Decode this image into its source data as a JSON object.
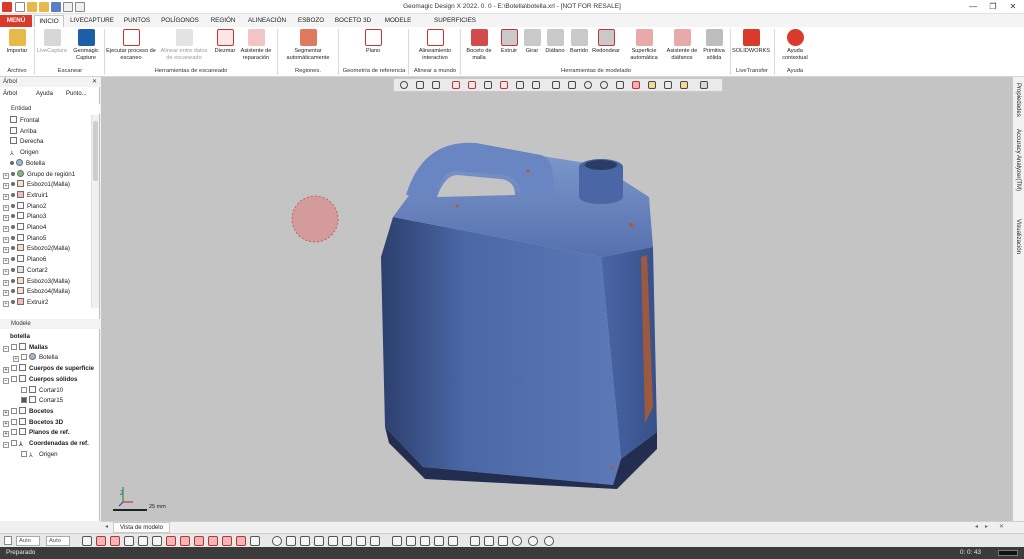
{
  "window": {
    "title": "Geomagic Design X 2022. 0. 0 - E:\\Botella\\botella.xrl - [NOT FOR RESALE]"
  },
  "tabs": [
    "MENÚ",
    "INICIO",
    "LIVECAPTURE",
    "PUNTOS",
    "POLÍGONOS",
    "REGIÓN",
    "ALINEACIÓN",
    "ESBOZO",
    "BOCETO 3D",
    "MODELE",
    "SUPERFICIES EXACTAS"
  ],
  "ribbon": {
    "buttons": {
      "importar": "Importar",
      "livecapture": "LiveCapture",
      "geomagic_capture": "Geomagic Capture",
      "ejecutar": "Ejecutar proceso de escaneo",
      "alinear": "Alinear entre datos de escaneado",
      "diezmar": "Diezmar",
      "asistente_reparacion": "Asistente de reparación",
      "segmentar": "Segmentar automáticamente",
      "plano": "Plano",
      "alineamiento": "Alineamiento interactivo",
      "boceto_malla": "Boceto de malla",
      "extruir": "Extruir",
      "girar": "Girar",
      "diafano": "Diáfano",
      "barrido": "Barrido",
      "redondear": "Redondear",
      "superficie_auto": "Superficie automática",
      "asistente_diafanos": "Asistente de diáfanos",
      "primitiva_solida": "Primitiva sólida",
      "solidworks": "SOLIDWORKS",
      "ayuda_contextual": "Ayuda contextual"
    },
    "groups": {
      "archivo": "Archivo",
      "escanear": "Escanear",
      "herr_escaneado": "Herramientas de escaneado",
      "regiones": "Regiones.",
      "geometria": "Geometría de referencia",
      "alinear_mundo": "Alinear a mundo",
      "herr_modelado": "Herramientas de modelado",
      "livetransfer": "LiveTransfer",
      "ayuda": "Ayuda"
    }
  },
  "tree_panel": {
    "title": "Árbol",
    "tabs": [
      "Árbol",
      "Ayuda",
      "Punto..."
    ],
    "section": "Entidad",
    "items": [
      "Frontal",
      "Arriba",
      "Derecha",
      "Origen",
      "Botella",
      "Grupo de región1",
      "Esbozo1(Malla)",
      "Extruir1",
      "Plano2",
      "Plano3",
      "Plano4",
      "Plano5",
      "Esbozo2(Malla)",
      "Plano6",
      "Cortar2",
      "Esbozo3(Malla)",
      "Esbozo4(Malla)",
      "Extruir2"
    ]
  },
  "model_panel": {
    "title": "Modele",
    "root": "botella",
    "items": [
      "Mallas",
      "Botella",
      "Cuerpos de superficie",
      "Cuerpos sólidos",
      "Cortar10",
      "Cortar15",
      "Bocetos",
      "Bocetos 3D",
      "Planos de ref.",
      "Coordenadas de ref.",
      "Origen"
    ]
  },
  "right_dock": [
    "Propiedades",
    "Accuracy Analyzer(TM)",
    "Visualización"
  ],
  "viewport": {
    "scale_label": "25 mm",
    "tab": "Vista de modelo"
  },
  "bottom": {
    "auto1": "Auto",
    "auto2": "Auto"
  },
  "status": {
    "left": "Preparado",
    "right": "0: 0: 43"
  },
  "colors": {
    "menu_red": "#d93a2b",
    "mesh_blue": "#4d6aa7",
    "viewport_bg": "#c4c4c4"
  }
}
